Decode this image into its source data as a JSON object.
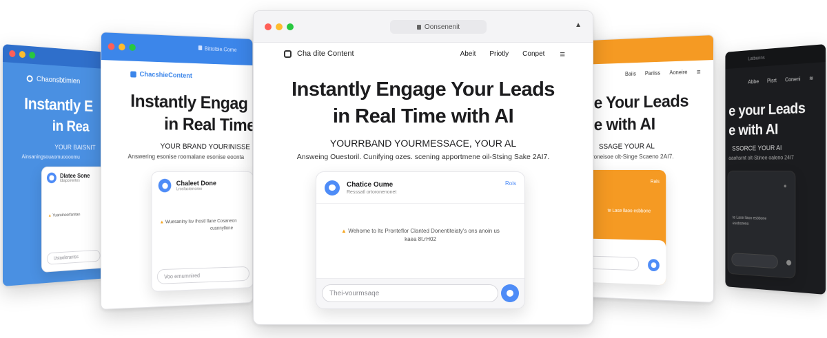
{
  "center": {
    "url": "Oonsenenit",
    "brand": "Cha dite Content",
    "nav": [
      "Abeit",
      "Priotly",
      "Conpet"
    ],
    "headline_1": "Instantly Engage Your Leads",
    "headline_2": "in Real Time with AI",
    "tagline": "YOURRBAND YOURMESSACE, YOUR AL",
    "subtext": "Answeing Ouestoril. Cunifying ozes. scening apportmene oil-Stsing Sake 2AI7.",
    "chat": {
      "title": "Chatice Oume",
      "subtitle": "Resssatl ortoronenonet",
      "action": "Rois",
      "message_1": "Wehome to ltc Pronteflor Clanted Donentiteiaty's ons anoin us",
      "message_2": "kaea 8t.rH02",
      "input_placeholder": "Thei-vourmsaqe"
    }
  },
  "left2": {
    "url": "Bittolbie.Come",
    "brand": "ChacshieContent",
    "headline_1": "Instantly Engag",
    "headline_2": "in Real Time",
    "tagline": "YOUR BRAND YOURINISSE",
    "subtext": "Answering esonise roomalane esonise eoonta",
    "chat": {
      "title": "Chaleet Done",
      "subtitle": "Lrosfacleinoree",
      "message_1": "Wuesaniny lsv Ihostl llane Cosaneon",
      "message_2": "cusnnyllone",
      "input_placeholder": "Voo ernumnired"
    }
  },
  "left1": {
    "brand": "Chaonsbtimien",
    "headline_1": "Instantly E",
    "headline_2": "in Rea",
    "tagline": "YOUR BAISNIT",
    "subtext": "Ainsaningsouaomuoooomu",
    "chat": {
      "title": "Dlatee Sone",
      "subtitle": "ldlapoirentes",
      "message_1": "Yuaruinoorfanitan",
      "input_placeholder": "Ustaolerantss"
    }
  },
  "right2": {
    "nav": [
      "Baiis",
      "Pariiss",
      "Aoneire"
    ],
    "headline_1": "e Your Leads",
    "headline_2": "e with AI",
    "tagline": "SSAGE YOUR AL",
    "subtext": "aparoneisoe olt-Singe Scaeno 2AI7.",
    "chat": {
      "action": "Rais",
      "message_1": "te Lase llaoo esbbone"
    }
  },
  "right1": {
    "url": "Latbunns",
    "nav": [
      "Abbe",
      "Pisrt",
      "Coneni"
    ],
    "headline_1": "e your Leads",
    "headline_2": "e with AI",
    "tagline": "SSORCE YOUR AI",
    "subtext": "aaohsrnt olt-Stinee oaleno 24I7",
    "chat": {
      "message_1": "te Lase llaoo esbbone",
      "message_2": "esoboreno"
    }
  },
  "colors": {
    "blue_accent": "#4e8cf7",
    "orange_accent": "#f59a23",
    "dark_bg": "#1b1c1f",
    "left_blue": "#4a90e2"
  }
}
